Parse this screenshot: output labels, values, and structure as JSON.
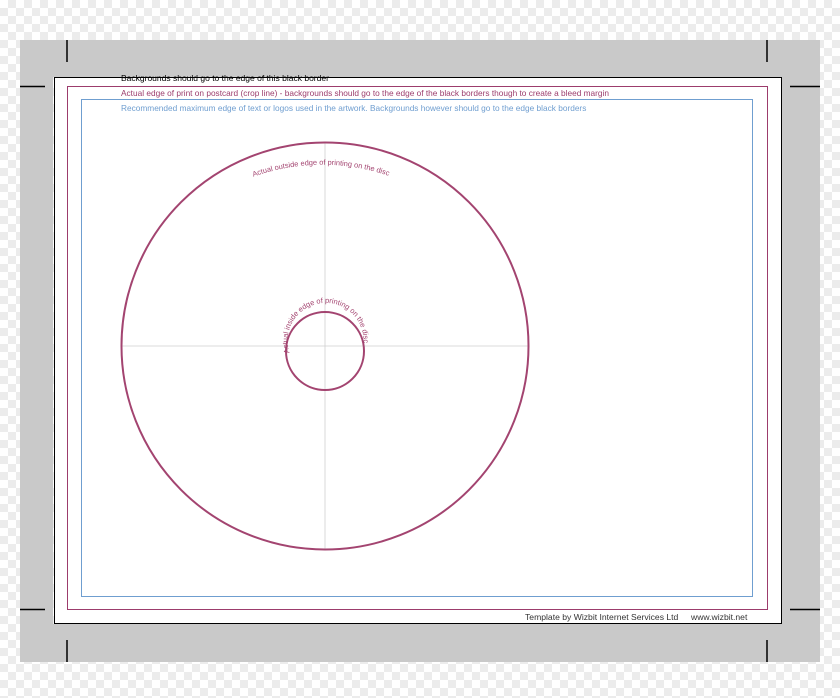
{
  "colors": {
    "background_checker": "#ececec",
    "gray_band": "#c9c9c9",
    "black_border": "#000000",
    "crop_line": "#9c3c6c",
    "safe_line": "#6f9ed0",
    "disc_outline": "#a34470",
    "guide_line": "#cfcfcf"
  },
  "labels": {
    "black_border": "Backgrounds should go to the edge of this black border",
    "crop_line": "Actual edge of print on postcard (crop line) - backgrounds should go to the edge of the black borders though to create a bleed margin",
    "safe_area": "Recommended maximum edge of text or logos used in the artwork. Backgrounds however should go to the edge black borders",
    "outer_disc": "Actual outside edge of printing on the disc",
    "inner_disc": "Actual inside edge of printing on the disc",
    "footer_left": "Template by Wizbit Internet Services Ltd",
    "footer_right": "www.wizbit.net"
  }
}
